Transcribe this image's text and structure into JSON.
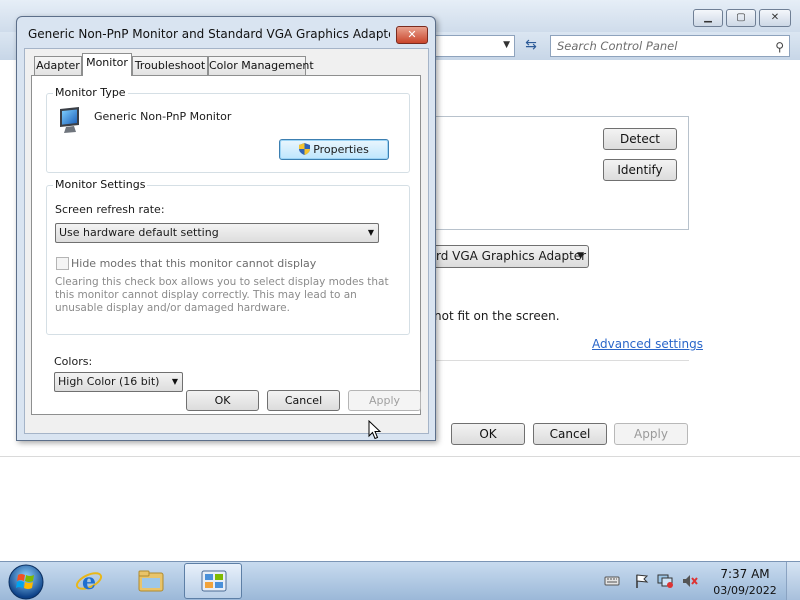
{
  "background_window": {
    "search_placeholder": "Search Control Panel",
    "detect_label": "Detect",
    "identify_label": "Identify",
    "adapter_select": "rd VGA Graphics Adapter",
    "fit_text": "not fit on the screen.",
    "advanced_link": "Advanced settings",
    "ok_label": "OK",
    "cancel_label": "Cancel",
    "apply_label": "Apply"
  },
  "dialog": {
    "title": "Generic Non-PnP Monitor and Standard VGA Graphics Adapter Pro...",
    "close_glyph": "✕",
    "tabs": [
      {
        "label": "Adapter"
      },
      {
        "label": "Monitor"
      },
      {
        "label": "Troubleshoot"
      },
      {
        "label": "Color Management"
      }
    ],
    "monitor_type": {
      "group_label": "Monitor Type",
      "name": "Generic Non-PnP Monitor",
      "properties_label": "Properties"
    },
    "monitor_settings": {
      "group_label": "Monitor Settings",
      "refresh_label": "Screen refresh rate:",
      "refresh_value": "Use hardware default setting",
      "hide_modes_label": "Hide modes that this monitor cannot display",
      "hide_modes_checked": false,
      "help_text": "Clearing this check box allows you to select display modes that this monitor cannot display correctly. This may lead to an unusable display and/or damaged hardware."
    },
    "colors": {
      "label": "Colors:",
      "value": "High Color (16 bit)"
    },
    "buttons": {
      "ok": "OK",
      "cancel": "Cancel",
      "apply": "Apply"
    }
  },
  "taskbar": {
    "time": "7:37 AM",
    "date": "03/09/2022"
  },
  "colors": {
    "accent": "#3c7fb1",
    "link": "#2a66c9",
    "close_red": "#c9452b"
  }
}
